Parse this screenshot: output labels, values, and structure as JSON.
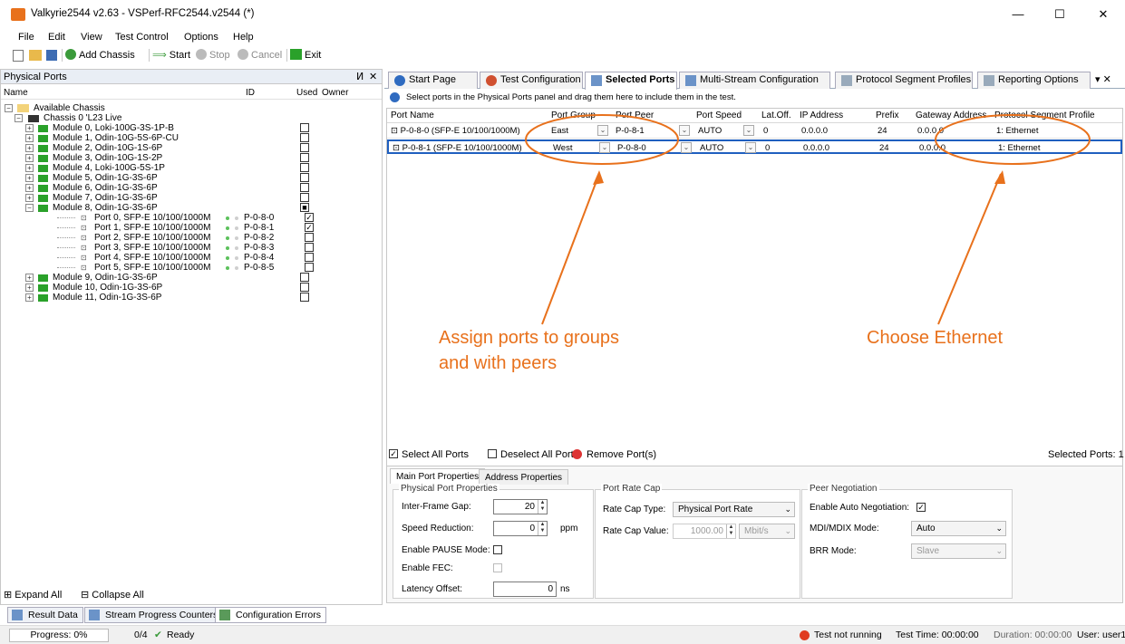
{
  "window": {
    "title": "Valkyrie2544 v2.63 - VSPerf-RFC2544.v2544 (*)",
    "minimize": "—",
    "maximize": "☐",
    "close": "✕"
  },
  "menu": [
    "File",
    "Edit",
    "View",
    "Test Control",
    "Options",
    "Help"
  ],
  "toolbar": {
    "add_chassis": "Add Chassis",
    "start": "Start",
    "stop": "Stop",
    "cancel": "Cancel",
    "exit": "Exit"
  },
  "physical_ports": {
    "title": "Physical Ports",
    "pin": "ⵍ",
    "close": "✕",
    "columns": {
      "name": "Name",
      "id": "ID",
      "used": "Used",
      "owner": "Owner"
    },
    "root": "Available Chassis",
    "chassis": "Chassis 0 'L23 Live",
    "modules": [
      {
        "name": "Module 0, Loki-100G-3S-1P-B",
        "used": ""
      },
      {
        "name": "Module 1, Odin-10G-5S-6P-CU",
        "used": ""
      },
      {
        "name": "Module 2, Odin-10G-1S-6P",
        "used": ""
      },
      {
        "name": "Module 3, Odin-10G-1S-2P",
        "used": ""
      },
      {
        "name": "Module 4, Loki-100G-5S-1P",
        "used": ""
      },
      {
        "name": "Module 5, Odin-1G-3S-6P",
        "used": ""
      },
      {
        "name": "Module 6, Odin-1G-3S-6P",
        "used": ""
      },
      {
        "name": "Module 7, Odin-1G-3S-6P",
        "used": ""
      },
      {
        "name": "Module 8, Odin-1G-3S-6P",
        "used": "■"
      }
    ],
    "ports": [
      {
        "name": "Port 0, SFP-E 10/100/1000M",
        "id": "P-0-8-0",
        "used": "✓"
      },
      {
        "name": "Port 1, SFP-E 10/100/1000M",
        "id": "P-0-8-1",
        "used": "✓"
      },
      {
        "name": "Port 2, SFP-E 10/100/1000M",
        "id": "P-0-8-2",
        "used": ""
      },
      {
        "name": "Port 3, SFP-E 10/100/1000M",
        "id": "P-0-8-3",
        "used": ""
      },
      {
        "name": "Port 4, SFP-E 10/100/1000M",
        "id": "P-0-8-4",
        "used": ""
      },
      {
        "name": "Port 5, SFP-E 10/100/1000M",
        "id": "P-0-8-5",
        "used": ""
      }
    ],
    "modules_after": [
      {
        "name": "Module 9, Odin-1G-3S-6P",
        "used": ""
      },
      {
        "name": "Module 10, Odin-1G-3S-6P",
        "used": ""
      },
      {
        "name": "Module 11, Odin-1G-3S-6P",
        "used": ""
      }
    ],
    "expand_all": "Expand All",
    "collapse_all": "Collapse All"
  },
  "tabs": [
    "Start Page",
    "Test Configuration",
    "Selected Ports",
    "Multi-Stream Configuration",
    "Protocol Segment Profiles",
    "Reporting Options"
  ],
  "tabs_menu": "▾ ✕",
  "info": "Select ports in the Physical Ports panel and drag them here to include them in the test.",
  "grid": {
    "columns": [
      "Port Name",
      "Port Group",
      "Port Peer",
      "Port Speed",
      "Lat.Off.",
      "IP Address",
      "Prefix",
      "Gateway Address",
      "Protocol Segment Profile"
    ],
    "rows": [
      {
        "name": "P-0-8-0 (SFP-E 10/100/1000M)",
        "group": "East",
        "peer": "P-0-8-1",
        "speed": "AUTO",
        "latoff": "0",
        "ip": "0.0.0.0",
        "prefix": "24",
        "gateway": "0.0.0.0",
        "profile": "1: Ethernet"
      },
      {
        "name": "P-0-8-1 (SFP-E 10/100/1000M)",
        "group": "West",
        "peer": "P-0-8-0",
        "speed": "AUTO",
        "latoff": "0",
        "ip": "0.0.0.0",
        "prefix": "24",
        "gateway": "0.0.0.0",
        "profile": "1: Ethernet"
      }
    ]
  },
  "selection": {
    "select_all": "Select All Ports",
    "deselect_all": "Deselect All Ports",
    "remove": "Remove Port(s)",
    "selected_count": "Selected Ports: 1"
  },
  "props": {
    "tabs": [
      "Main Port Properties",
      "Address Properties"
    ],
    "physical": {
      "title": "Physical Port Properties",
      "ifg_label": "Inter-Frame Gap:",
      "ifg_value": "20",
      "speed_red_label": "Speed Reduction:",
      "speed_red_value": "0",
      "speed_red_unit": "ppm",
      "pause_label": "Enable PAUSE Mode:",
      "fec_label": "Enable FEC:",
      "latency_label": "Latency Offset:",
      "latency_value": "0",
      "latency_unit": "ns"
    },
    "rate_cap": {
      "title": "Port Rate Cap",
      "type_label": "Rate Cap Type:",
      "type_value": "Physical Port Rate",
      "value_label": "Rate Cap Value:",
      "value": "1000.00",
      "unit": "Mbit/s"
    },
    "peer": {
      "title": "Peer Negotiation",
      "auto_label": "Enable Auto Negotiation:",
      "auto_value": "✓",
      "mdi_label": "MDI/MDIX Mode:",
      "mdi_value": "Auto",
      "brr_label": "BRR Mode:",
      "brr_value": "Slave"
    }
  },
  "bottom_tabs": [
    "Result Data",
    "Stream Progress Counters",
    "Configuration Errors"
  ],
  "status": {
    "progress": "Progress: 0%",
    "count": "0/4",
    "ready": "Ready",
    "test_state": "Test not running",
    "test_time": "Test Time: 00:00:00",
    "duration": "Duration: 00:00:00",
    "user": "User: user1"
  },
  "annotations": {
    "left": [
      "Assign ports to groups",
      "and with peers"
    ],
    "right": "Choose Ethernet"
  },
  "colors": {
    "accent": "#e8711c",
    "module_green": "#2aa12a",
    "selection": "#1f5fbf"
  }
}
